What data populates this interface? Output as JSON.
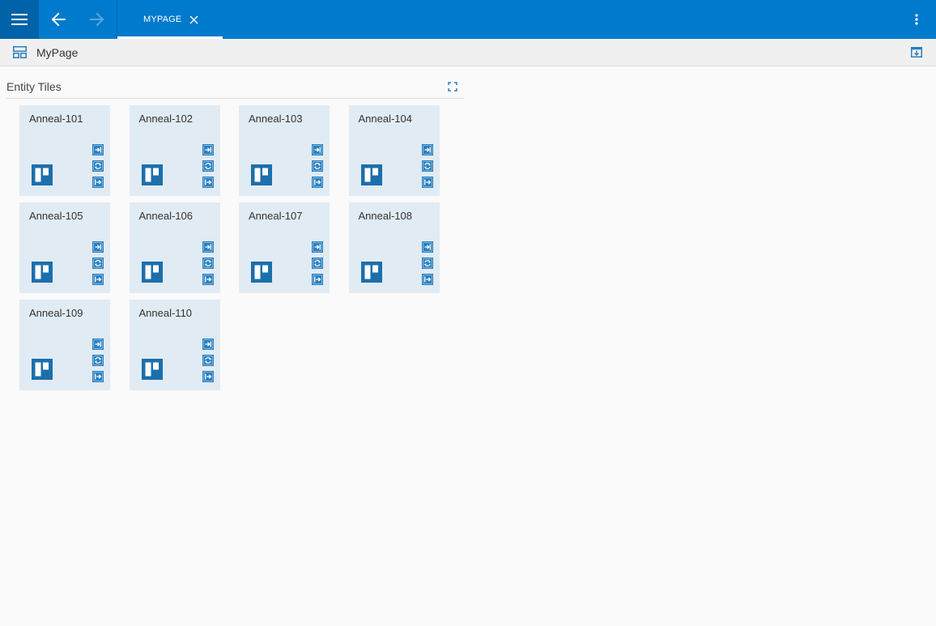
{
  "topbar": {
    "tab_label": "MYPAGE"
  },
  "pagebar": {
    "title": "MyPage"
  },
  "panel": {
    "title": "Entity Tiles"
  },
  "tiles": [
    {
      "name": "Anneal-101"
    },
    {
      "name": "Anneal-102"
    },
    {
      "name": "Anneal-103"
    },
    {
      "name": "Anneal-104"
    },
    {
      "name": "Anneal-105"
    },
    {
      "name": "Anneal-106"
    },
    {
      "name": "Anneal-107"
    },
    {
      "name": "Anneal-108"
    },
    {
      "name": "Anneal-109"
    },
    {
      "name": "Anneal-110"
    }
  ],
  "icons": {
    "menu": "hamburger-icon",
    "back": "arrow-left-icon",
    "forward": "arrow-right-icon",
    "close": "close-icon",
    "more": "more-vertical-icon",
    "page": "layout-icon",
    "export": "export-icon",
    "expand": "expand-icon",
    "tile_logo": "entity-board-icon",
    "action_1": "sign-in-icon",
    "action_2": "refresh-icon",
    "action_3": "sign-out-icon"
  },
  "colors": {
    "topbar": "#007acc",
    "menu_button": "#0062a8",
    "tile_background": "#e1ebf3",
    "tile_icon": "#1c6fab",
    "action_icon": "#2a80c0"
  }
}
